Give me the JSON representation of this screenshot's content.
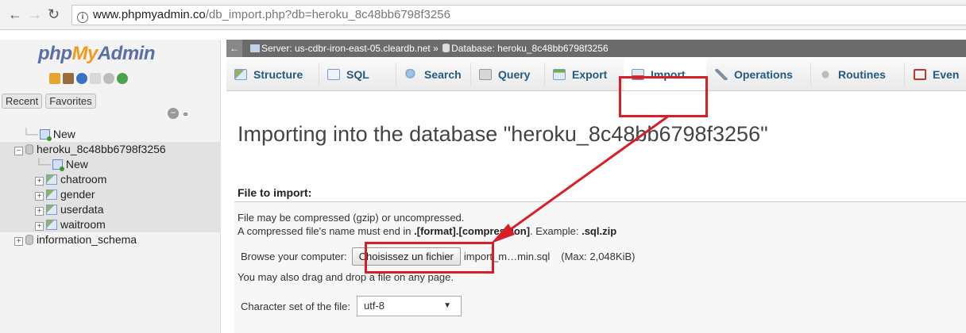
{
  "browser": {
    "url_host": "www.phpmyadmin.co",
    "url_path": "/db_import.php?db=heroku_8c48bb6798f3256"
  },
  "sidebar": {
    "logo": {
      "php": "php",
      "my": "My",
      "admin": "Admin"
    },
    "tabs": [
      "Recent",
      "Favorites"
    ],
    "tree": {
      "new_root": "New",
      "database": "heroku_8c48bb6798f3256",
      "new_table": "New",
      "tables": [
        "chatroom",
        "gender",
        "userdata",
        "waitroom"
      ],
      "other_db": "information_schema"
    }
  },
  "breadcrumb": {
    "server_label": "Server: us-cdbr-iron-east-05.cleardb.net",
    "separator": "»",
    "database_label": "Database: heroku_8c48bb6798f3256"
  },
  "tabs": [
    {
      "label": "Structure",
      "icon": "structure-icon"
    },
    {
      "label": "SQL",
      "icon": "sql-icon"
    },
    {
      "label": "Search",
      "icon": "search-icon"
    },
    {
      "label": "Query",
      "icon": "query-icon"
    },
    {
      "label": "Export",
      "icon": "export-icon"
    },
    {
      "label": "Import",
      "icon": "import-icon",
      "active": true
    },
    {
      "label": "Operations",
      "icon": "operations-icon"
    },
    {
      "label": "Routines",
      "icon": "routines-icon"
    },
    {
      "label": "Even",
      "icon": "events-icon"
    }
  ],
  "main": {
    "title": "Importing into the database \"heroku_8c48bb6798f3256\"",
    "section_title": "File to import:",
    "info_line1": "File may be compressed (gzip) or uncompressed.",
    "info_line2_prefix": "A compressed file's name must end in ",
    "info_line2_format": ".[format].[compression]",
    "info_line2_example_label": ". Example: ",
    "info_line2_example": ".sql.zip",
    "browse_label": "Browse your computer:",
    "browse_button": "Choisissez un fichier",
    "file_name": "import_m…min.sql",
    "max_size": "(Max: 2,048KiB)",
    "drag_note": "You may also drag and drop a file on any page.",
    "charset_label": "Character set of the file:",
    "charset_value": "utf-8"
  },
  "colors": {
    "annotation": "#d81f27",
    "link": "#235a81",
    "breadcrumb_bg": "#6b6b6b"
  }
}
